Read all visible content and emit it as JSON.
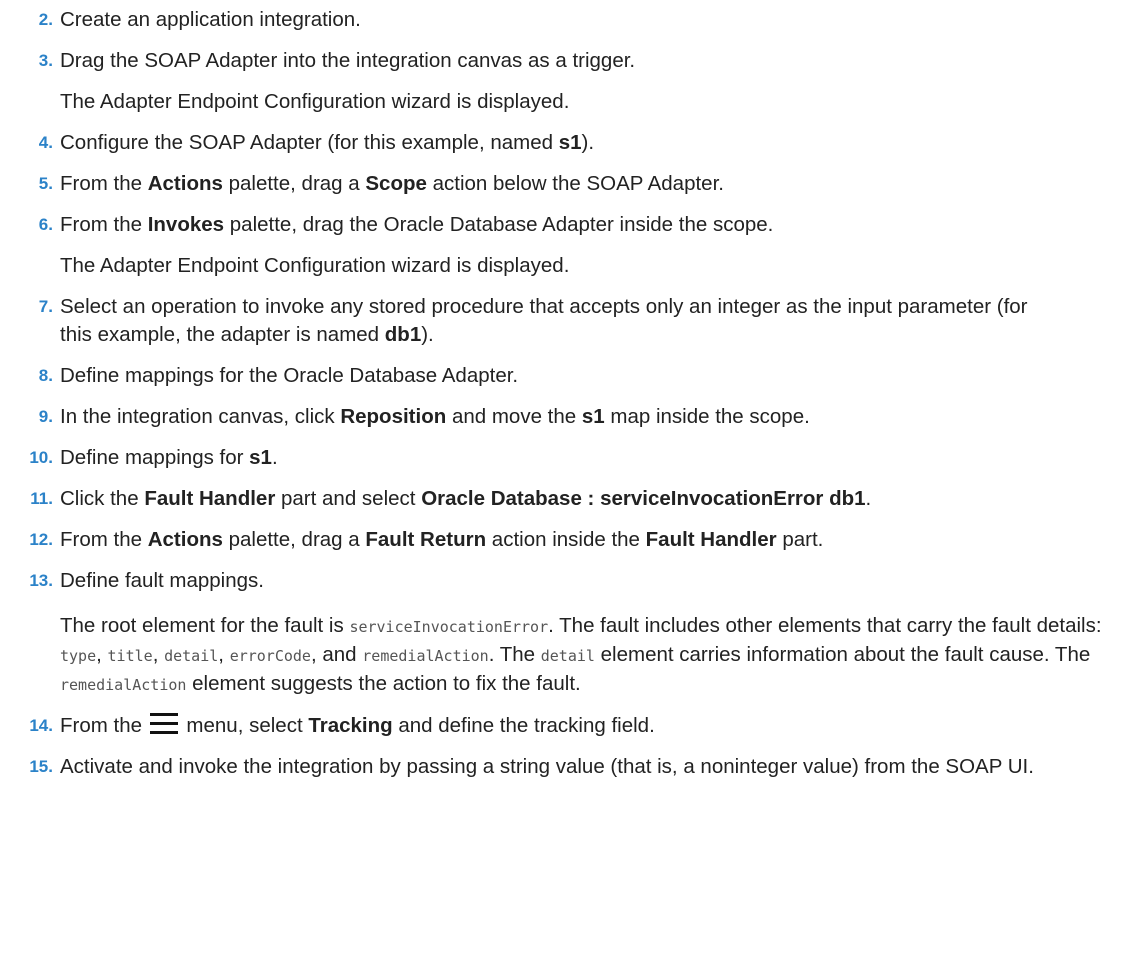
{
  "steps": [
    {
      "number": "2",
      "text": "Create an application integration."
    },
    {
      "number": "3",
      "text": "Drag the SOAP Adapter into the integration canvas as a trigger.",
      "note": "The Adapter Endpoint Configuration wizard is displayed."
    },
    {
      "number": "4",
      "t1": "Configure the SOAP Adapter (for this example, named ",
      "b1": "s1",
      "t2": ")."
    },
    {
      "number": "5",
      "t1": "From the ",
      "b1": "Actions",
      "t2": " palette, drag a ",
      "b2": "Scope",
      "t3": " action below the SOAP Adapter."
    },
    {
      "number": "6",
      "t1": "From the ",
      "b1": "Invokes",
      "t2": " palette, drag the Oracle Database Adapter inside the scope.",
      "note": "The Adapter Endpoint Configuration wizard is displayed."
    },
    {
      "number": "7",
      "t1": "Select an operation to invoke any stored procedure that accepts only an integer as the input parameter (for this example, the adapter is named ",
      "b1": "db1",
      "t2": ")."
    },
    {
      "number": "8",
      "text": "Define mappings for the Oracle Database Adapter."
    },
    {
      "number": "9",
      "t1": "In the integration canvas, click ",
      "b1": "Reposition",
      "t2": " and move the ",
      "b2": "s1",
      "t3": " map inside the scope."
    },
    {
      "number": "10",
      "t1": "Define mappings for ",
      "b1": "s1",
      "t2": "."
    },
    {
      "number": "11",
      "t1": "Click the ",
      "b1": "Fault Handler",
      "t2": " part and select ",
      "b2": "Oracle Database : serviceInvocationError db1",
      "t3": "."
    },
    {
      "number": "12",
      "t1": "From the ",
      "b1": "Actions",
      "t2": " palette, drag a ",
      "b2": "Fault Return",
      "t3": " action inside the ",
      "b3": "Fault Handler",
      "t4": " part."
    },
    {
      "number": "13",
      "text": "Define fault mappings.",
      "detail": {
        "p1": "The root element for the fault is ",
        "c1": "serviceInvocationError",
        "p2": ". The fault includes other elements that carry the fault details: ",
        "c2": "type",
        "p3": ", ",
        "c3": "title",
        "p4": ", ",
        "c4": "detail",
        "p5": ", ",
        "c5": "errorCode",
        "p6": ", and ",
        "c6": "remedialAction",
        "p7": ". The ",
        "c7": "detail",
        "p8": " element carries information about the fault cause. The ",
        "c8": "remedialAction",
        "p9": " element suggests the action to fix the fault."
      }
    },
    {
      "number": "14",
      "t1": "From the ",
      "icon": "hamburger-menu-icon",
      "t2": " menu, select ",
      "b1": "Tracking",
      "t3": " and define the tracking field."
    },
    {
      "number": "15",
      "text": "Activate and invoke the integration by passing a string value (that is, a noninteger value) from the SOAP UI."
    }
  ],
  "colors": {
    "step_number": "#2b82c8",
    "text": "#222222",
    "code": "#555555"
  }
}
